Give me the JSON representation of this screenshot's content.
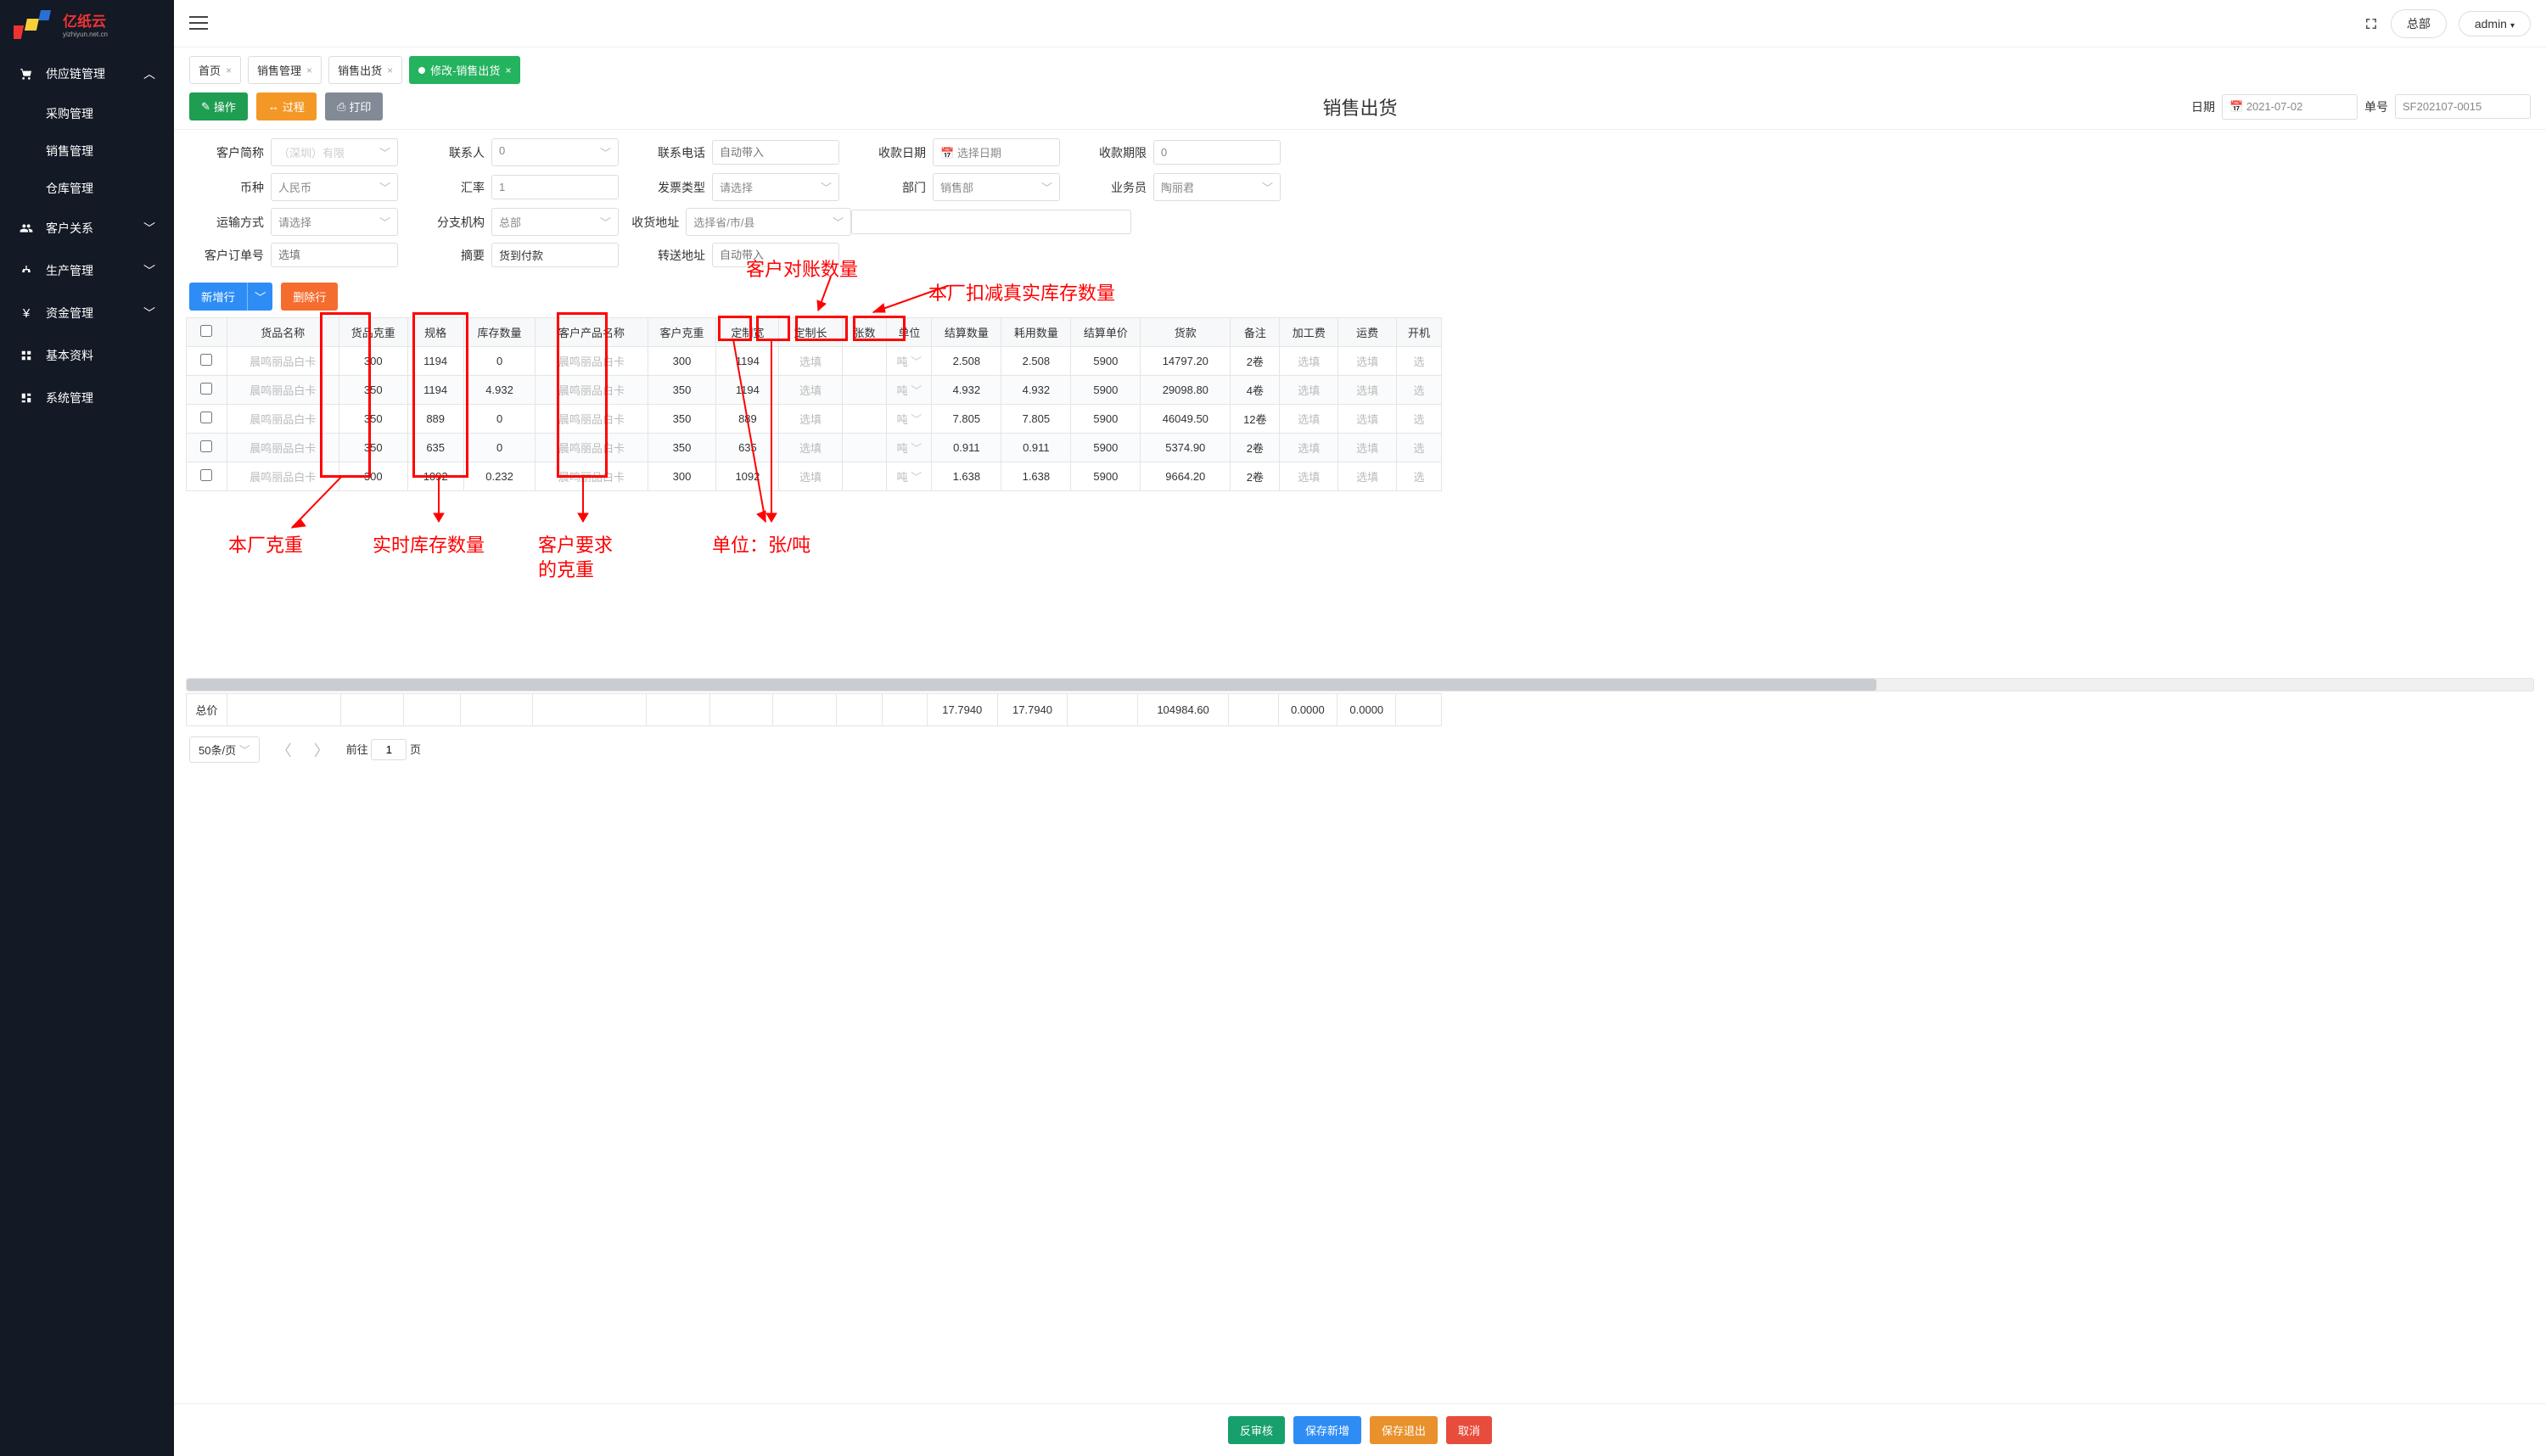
{
  "brand": {
    "cn": "亿纸云",
    "en": "yizhiyun.net.cn"
  },
  "sidebar": {
    "items": [
      {
        "label": "供应链管理",
        "expanded": true,
        "children": [
          "采购管理",
          "销售管理",
          "仓库管理"
        ]
      },
      {
        "label": "客户关系"
      },
      {
        "label": "生产管理"
      },
      {
        "label": "资金管理"
      },
      {
        "label": "基本资料"
      },
      {
        "label": "系统管理"
      }
    ]
  },
  "topbar": {
    "scope": "总部",
    "user": "admin"
  },
  "tabs": [
    {
      "label": "首页",
      "active": false
    },
    {
      "label": "销售管理",
      "active": false
    },
    {
      "label": "销售出货",
      "active": false
    },
    {
      "label": "修改-销售出货",
      "active": true
    }
  ],
  "toolbar": {
    "op": "操作",
    "process": "过程",
    "print": "打印"
  },
  "page_title": "销售出货",
  "header_fields": {
    "date_label": "日期",
    "date_value": "2021-07-02",
    "order_label": "单号",
    "order_value": "SF202107-0015"
  },
  "form": {
    "customer_short_lbl": "客户简称",
    "customer_short": "（深圳）有限",
    "contact_lbl": "联系人",
    "contact": "0",
    "phone_lbl": "联系电话",
    "phone_ph": "自动带入",
    "rcv_date_lbl": "收款日期",
    "rcv_date_ph": "选择日期",
    "rcv_limit_lbl": "收款期限",
    "rcv_limit": "0",
    "currency_lbl": "币种",
    "currency": "人民币",
    "rate_lbl": "汇率",
    "rate": "1",
    "inv_type_lbl": "发票类型",
    "inv_type_ph": "请选择",
    "dept_lbl": "部门",
    "dept": "销售部",
    "sales_lbl": "业务员",
    "sales": "陶丽君",
    "ship_lbl": "运输方式",
    "ship_ph": "请选择",
    "branch_lbl": "分支机构",
    "branch": "总部",
    "addr_lbl": "收货地址",
    "addr_ph": "选择省/市/县",
    "cust_order_lbl": "客户订单号",
    "cust_order_ph": "选填",
    "summary_lbl": "摘要",
    "summary": "货到付款",
    "fwd_addr_lbl": "转送地址",
    "fwd_addr_ph": "自动带入"
  },
  "tbl_actions": {
    "add": "新增行",
    "del": "删除行"
  },
  "columns": [
    "",
    "货品名称",
    "货品克重",
    "规格",
    "库存数量",
    "客户产品名称",
    "客户克重",
    "定制宽",
    "定制长",
    "张数",
    "单位",
    "结算数量",
    "耗用数量",
    "结算单价",
    "货款",
    "备注",
    "加工费",
    "运费",
    "开机"
  ],
  "rows": [
    {
      "name": "晨鸣丽品白卡",
      "gw": "300",
      "spec": "1194",
      "stock": "0",
      "cust_name": "晨鸣丽品白卡",
      "cust_gw": "300",
      "cw": "1194",
      "cl": "选填",
      "sheets": "",
      "unit": "吨",
      "qty": "2.508",
      "used": "2.508",
      "price": "5900",
      "amt": "14797.20",
      "note": "2卷",
      "proc": "选填",
      "ship": "选填",
      "km": "选"
    },
    {
      "name": "晨鸣丽品白卡",
      "gw": "350",
      "spec": "1194",
      "stock": "4.932",
      "cust_name": "晨鸣丽品白卡",
      "cust_gw": "350",
      "cw": "1194",
      "cl": "选填",
      "sheets": "",
      "unit": "吨",
      "qty": "4.932",
      "used": "4.932",
      "price": "5900",
      "amt": "29098.80",
      "note": "4卷",
      "proc": "选填",
      "ship": "选填",
      "km": "选"
    },
    {
      "name": "晨鸣丽品白卡",
      "gw": "350",
      "spec": "889",
      "stock": "0",
      "cust_name": "晨鸣丽品白卡",
      "cust_gw": "350",
      "cw": "889",
      "cl": "选填",
      "sheets": "",
      "unit": "吨",
      "qty": "7.805",
      "used": "7.805",
      "price": "5900",
      "amt": "46049.50",
      "note": "12卷",
      "proc": "选填",
      "ship": "选填",
      "km": "选"
    },
    {
      "name": "晨鸣丽品白卡",
      "gw": "350",
      "spec": "635",
      "stock": "0",
      "cust_name": "晨鸣丽品白卡",
      "cust_gw": "350",
      "cw": "635",
      "cl": "选填",
      "sheets": "",
      "unit": "吨",
      "qty": "0.911",
      "used": "0.911",
      "price": "5900",
      "amt": "5374.90",
      "note": "2卷",
      "proc": "选填",
      "ship": "选填",
      "km": "选"
    },
    {
      "name": "晨鸣丽品白卡",
      "gw": "300",
      "spec": "1092",
      "stock": "0.232",
      "cust_name": "晨鸣丽品白卡",
      "cust_gw": "300",
      "cw": "1092",
      "cl": "选填",
      "sheets": "",
      "unit": "吨",
      "qty": "1.638",
      "used": "1.638",
      "price": "5900",
      "amt": "9664.20",
      "note": "2卷",
      "proc": "选填",
      "ship": "选填",
      "km": "选"
    }
  ],
  "totals": {
    "label": "总价",
    "qty": "17.7940",
    "used": "17.7940",
    "amt": "104984.60",
    "proc": "0.0000",
    "ship": "0.0000"
  },
  "pager": {
    "size": "50条/页",
    "goto_pre": "前往",
    "goto_val": "1",
    "goto_suf": "页"
  },
  "bottom": {
    "unaudit": "反审核",
    "save_new": "保存新增",
    "save_exit": "保存退出",
    "cancel": "取消"
  },
  "annotations": {
    "cust_qty": "客户对账数量",
    "fac_deduct": "本厂扣减真实库存数量",
    "fac_gw": "本厂克重",
    "rt_stock": "实时库存数量",
    "cust_gw": "客户要求\n的克重",
    "unit": "单位：张/吨"
  }
}
